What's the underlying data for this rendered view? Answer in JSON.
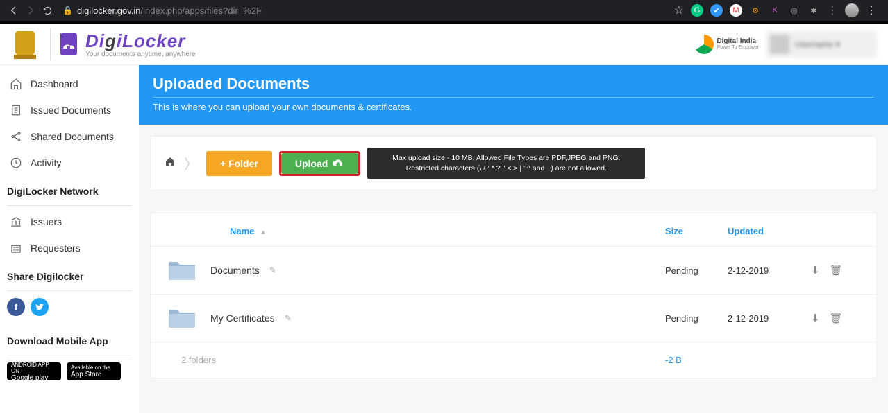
{
  "browser": {
    "url_host": "digilocker.gov.in",
    "url_path": "/index.php/apps/files?dir=%2F",
    "star": "☆"
  },
  "brand": {
    "name": "DigiLocker",
    "tagline": "Your documents anytime, anywhere"
  },
  "header_right": {
    "digital_india": "Digital India",
    "digital_india_sub": "Power To Empower"
  },
  "sidebar": {
    "items": [
      {
        "label": "Dashboard"
      },
      {
        "label": "Issued Documents"
      },
      {
        "label": "Shared Documents"
      },
      {
        "label": "Activity"
      }
    ],
    "network_heading": "DigiLocker Network",
    "network_items": [
      {
        "label": "Issuers"
      },
      {
        "label": "Requesters"
      }
    ],
    "share_heading": "Share Digilocker",
    "download_heading": "Download Mobile App",
    "stores": {
      "google_top": "ANDROID APP ON",
      "google": "Google play",
      "apple_top": "Available on the",
      "apple": "App Store"
    }
  },
  "page": {
    "title": "Uploaded Documents",
    "subtitle": "This is where you can upload your own documents & certificates.",
    "btn_folder": "+ Folder",
    "btn_upload": "Upload",
    "upload_tip": "Max upload size - 10 MB, Allowed File Types are PDF,JPEG and PNG. Restricted characters (\\ / : * ? \" < > | ' ^ and ~) are not allowed."
  },
  "table": {
    "col_name": "Name",
    "col_size": "Size",
    "col_updated": "Updated",
    "rows": [
      {
        "name": "Documents",
        "size": "Pending",
        "updated": "2-12-2019"
      },
      {
        "name": "My Certificates",
        "size": "Pending",
        "updated": "2-12-2019"
      }
    ],
    "summary_count": "2 folders",
    "summary_size": "-2 B"
  }
}
